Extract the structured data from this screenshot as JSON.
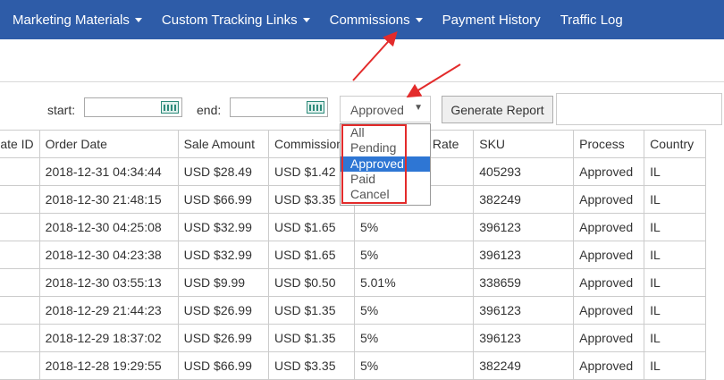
{
  "nav": {
    "items": [
      {
        "label": "Marketing Materials",
        "dropdown": true
      },
      {
        "label": "Custom Tracking Links",
        "dropdown": true
      },
      {
        "label": "Commissions",
        "dropdown": true
      },
      {
        "label": "Payment History",
        "dropdown": false
      },
      {
        "label": "Traffic Log",
        "dropdown": false
      }
    ]
  },
  "filters": {
    "start_label": "start:",
    "end_label": "end:",
    "start_value": "",
    "end_value": "",
    "status_selected": "Approved",
    "status_options": [
      "All",
      "Pending",
      "Approved",
      "Paid",
      "Cancel"
    ],
    "generate_label": "Generate Report"
  },
  "table": {
    "headers": [
      "ate ID",
      "Order Date",
      "Sale Amount",
      "Commission",
      "Commission Rate",
      "SKU",
      "Process",
      "Country"
    ],
    "rows": [
      [
        "",
        "2018-12-31 04:34:44",
        "USD $28.49",
        "USD $1.42",
        "",
        "405293",
        "Approved",
        "IL"
      ],
      [
        "",
        "2018-12-30 21:48:15",
        "USD $66.99",
        "USD $3.35",
        "",
        "382249",
        "Approved",
        "IL"
      ],
      [
        "",
        "2018-12-30 04:25:08",
        "USD $32.99",
        "USD $1.65",
        "5%",
        "396123",
        "Approved",
        "IL"
      ],
      [
        "",
        "2018-12-30 04:23:38",
        "USD $32.99",
        "USD $1.65",
        "5%",
        "396123",
        "Approved",
        "IL"
      ],
      [
        "",
        "2018-12-30 03:55:13",
        "USD $9.99",
        "USD $0.50",
        "5.01%",
        "338659",
        "Approved",
        "IL"
      ],
      [
        "",
        "2018-12-29 21:44:23",
        "USD $26.99",
        "USD $1.35",
        "5%",
        "396123",
        "Approved",
        "IL"
      ],
      [
        "",
        "2018-12-29 18:37:02",
        "USD $26.99",
        "USD $1.35",
        "5%",
        "396123",
        "Approved",
        "IL"
      ],
      [
        "",
        "2018-12-28 19:29:55",
        "USD $66.99",
        "USD $3.35",
        "5%",
        "382249",
        "Approved",
        "IL"
      ]
    ]
  },
  "colors": {
    "nav_bg": "#2e5ca8",
    "highlight": "#2e76d4",
    "annotation_red": "#e32b2b"
  },
  "icons": {
    "calendar": "calendar-icon",
    "dropdown": "chevron-down-icon"
  }
}
